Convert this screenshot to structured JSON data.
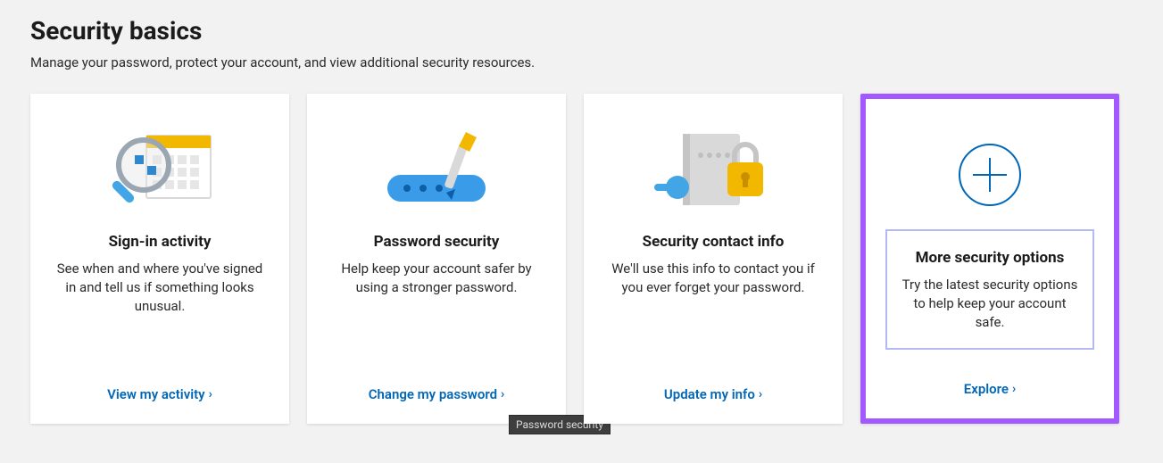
{
  "header": {
    "title": "Security basics",
    "subtitle": "Manage your password, protect your account, and view additional security resources."
  },
  "cards": [
    {
      "icon": "magnifier-calendar-icon",
      "title": "Sign-in activity",
      "desc": "See when and where you've signed in and tell us if something looks unusual.",
      "cta": "View my activity"
    },
    {
      "icon": "pen-password-icon",
      "title": "Password security",
      "desc": "Help keep your account safer by using a stronger password.",
      "cta": "Change my password",
      "tooltip": "Password security"
    },
    {
      "icon": "notebook-lock-icon",
      "title": "Security contact info",
      "desc": "We'll use this info to contact you if you ever forget your password.",
      "cta": "Update my info"
    },
    {
      "icon": "plus-circle-icon",
      "title": "More security options",
      "desc": "Try the latest security options to help keep your account safe.",
      "cta": "Explore",
      "highlighted": true,
      "inner_box": true
    }
  ],
  "colors": {
    "link": "#0067b8",
    "highlight_border": "#a259ff",
    "inner_box_border": "#b5b8f7"
  }
}
